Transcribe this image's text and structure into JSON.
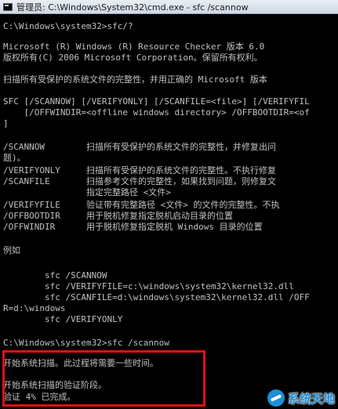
{
  "window": {
    "title": "管理员: C:\\Windows\\System32\\cmd.exe - sfc  /scannow",
    "icon": "console-window-icon"
  },
  "console": {
    "lines": [
      "C:\\Windows\\system32>sfc/?",
      "",
      "Microsoft (R) Windows (R) Resource Checker 版本 6.0",
      "版权所有(C) 2006 Microsoft Corporation。保留所有权利。",
      "",
      "扫描所有受保护的系统文件的完整性，并用正确的 Microsoft 版本",
      "",
      "SFC [/SCANNOW] [/VERIFYONLY] [/SCANFILE=<file>] [/VERIFYFIL",
      "    [/OFFWINDIR=<offline windows directory> /OFFBOOTDIR=<of",
      "]",
      "",
      "/SCANNOW        扫描所有受保护的系统文件的完整性，并修复出问",
      "题)。",
      "/VERIFYONLY     扫描所有受保护的系统文件的完整性。不执行修复",
      "/SCANFILE       扫描参考文件的完整性，如果找到问题，则修复文",
      "                指定完整路径 <文件>",
      "/VERIFYFILE     验证带有完整路径 <文件> 的文件的完整性。不执",
      "/OFFBOOTDIR     用于脱机修复指定脱机启动目录的位置",
      "/OFFWINDIR      用于脱机修复指定脱机 Windows 目录的位置",
      "",
      "例如",
      "",
      "        sfc /SCANNOW",
      "        sfc /VERIFYFILE=c:\\windows\\system32\\kernel32.dll",
      "        sfc /SCANFILE=d:\\windows\\system32\\kernel32.dll /OFF",
      "R=d:\\windows",
      "        sfc /VERIFYONLY",
      "",
      "C:\\Windows\\system32>sfc /scannow",
      "",
      "开始系统扫描。此过程将需要一些时间。",
      "",
      "开始系统扫描的验证阶段。",
      "验证 4% 已完成。"
    ]
  },
  "watermark": {
    "text": "系统天地",
    "icon": "site-logo-icon"
  },
  "colors": {
    "console_bg": "#000000",
    "console_text": "#c0c0c0",
    "highlight": "#e01010",
    "watermark": "#1d8fd8"
  }
}
